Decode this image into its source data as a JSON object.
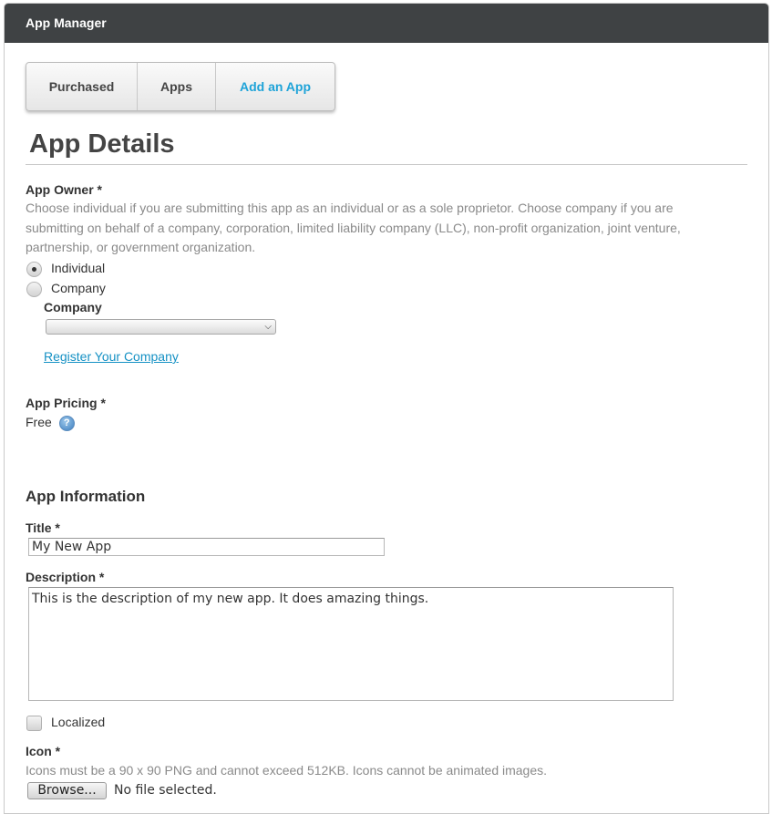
{
  "window": {
    "title": "App Manager"
  },
  "tabs": [
    {
      "label": "Purchased"
    },
    {
      "label": "Apps"
    },
    {
      "label": "Add an App",
      "active": true
    }
  ],
  "section_title": "App Details",
  "owner": {
    "label": "App Owner *",
    "help": "Choose individual if you are submitting this app as an individual or as a sole proprietor. Choose company if you are submitting on behalf of a company, corporation, limited liability company (LLC), non-profit organization, joint venture, partnership, or government organization.",
    "options": [
      {
        "label": "Individual",
        "selected": true
      },
      {
        "label": "Company",
        "selected": false
      }
    ],
    "company_label": "Company",
    "company_selected": "",
    "register_link": "Register Your Company"
  },
  "pricing": {
    "label": "App Pricing *",
    "value": "Free",
    "help_icon": "question-mark-icon"
  },
  "info": {
    "heading": "App Information",
    "title_label": "Title *",
    "title_value": "My New App",
    "description_label": "Description *",
    "description_value": "This is the description of my new app. It does amazing things.",
    "localized_label": "Localized",
    "localized_checked": false,
    "icon_label": "Icon *",
    "icon_help": "Icons must be a 90 x 90 PNG and cannot exceed 512KB. Icons cannot be animated images.",
    "browse_label": "Browse...",
    "file_status": "No file selected."
  },
  "colors": {
    "titlebar": "#3f4244",
    "active_tab": "#1ea3d8",
    "link": "#1591c4"
  }
}
